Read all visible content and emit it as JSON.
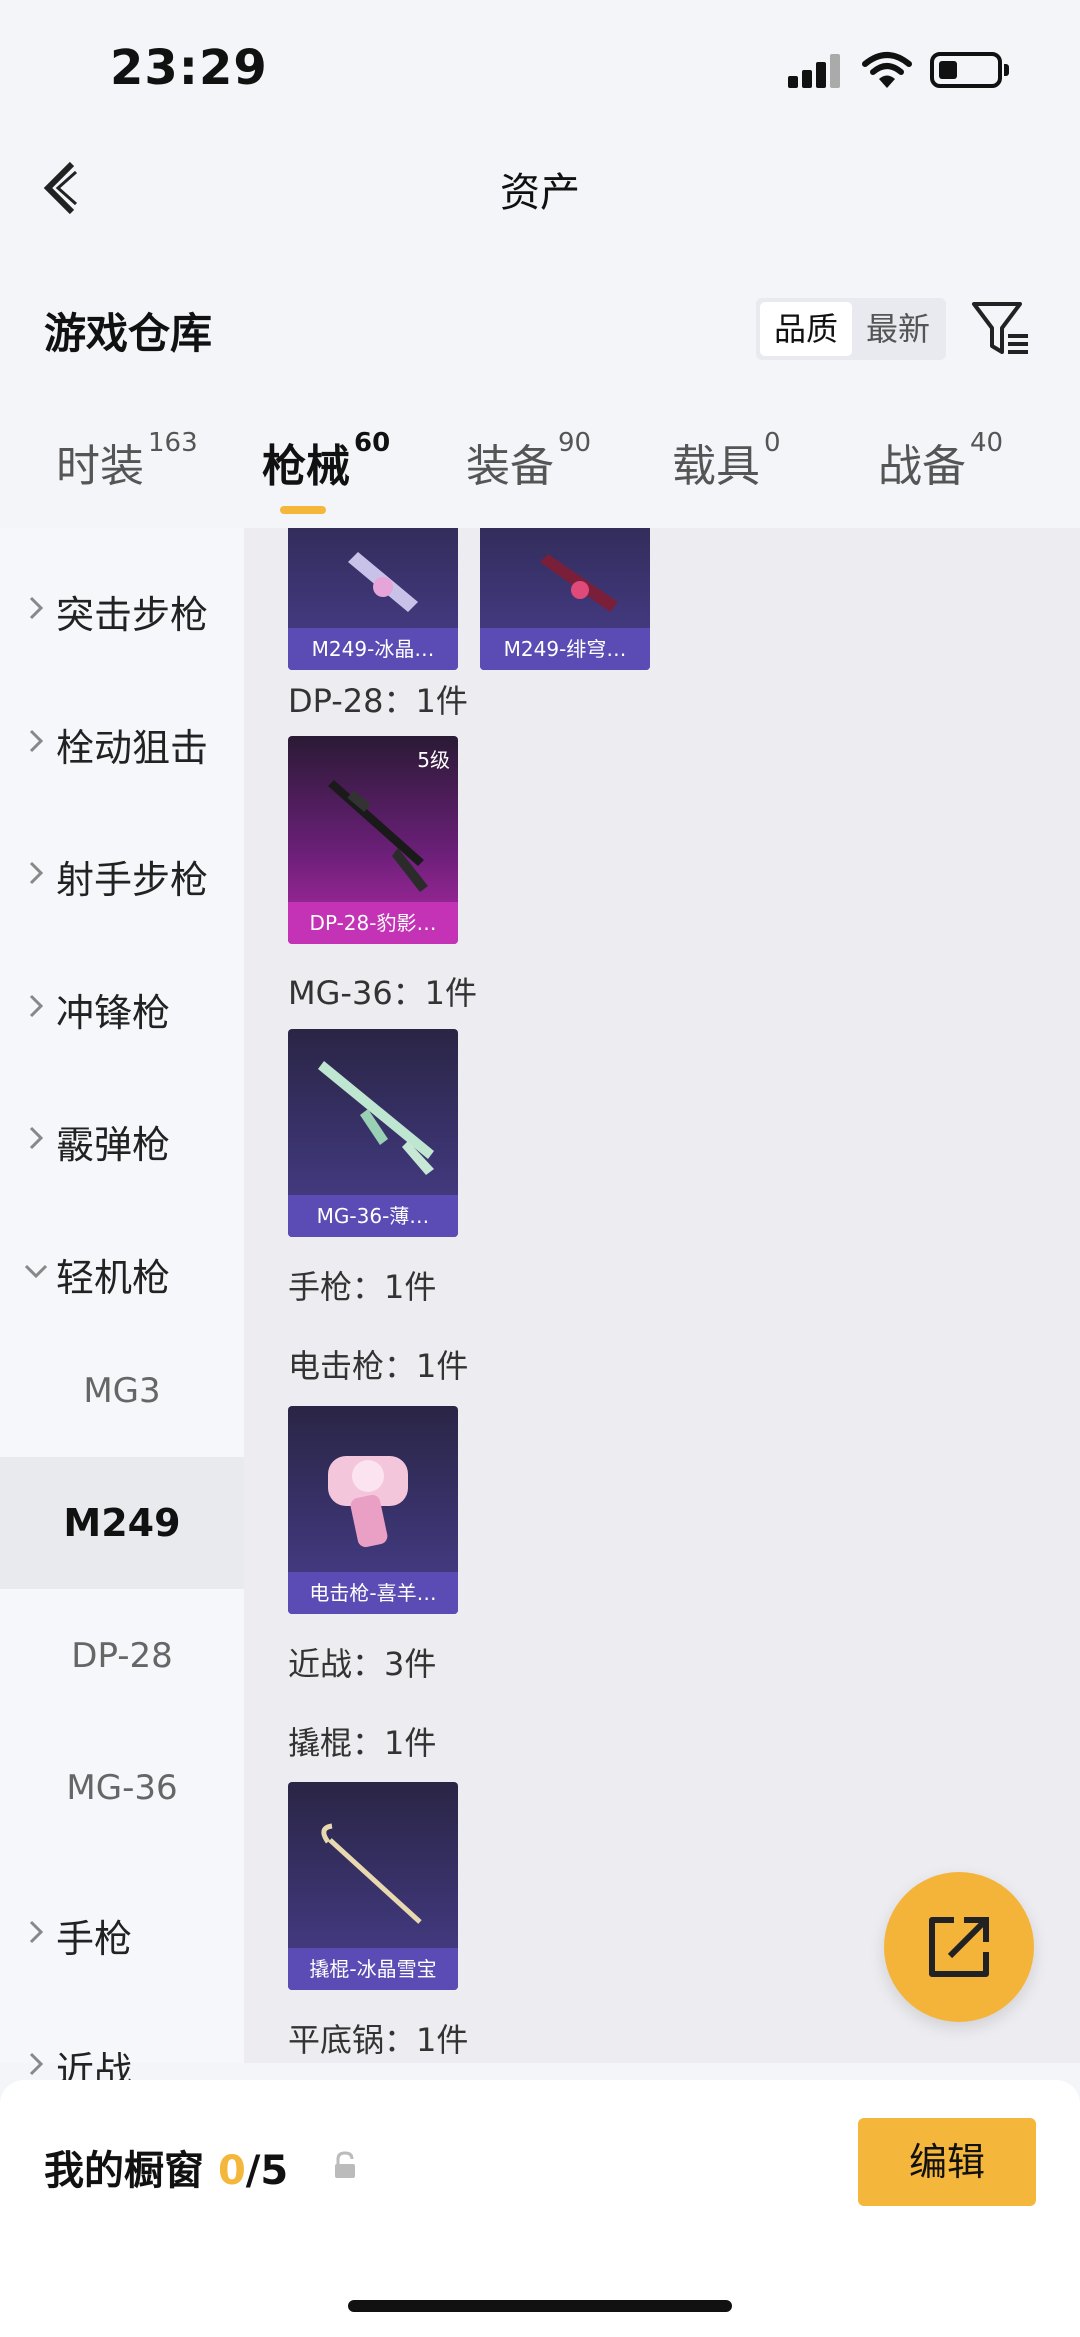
{
  "status": {
    "time": "23:29"
  },
  "nav": {
    "title": "资产"
  },
  "warehouse": {
    "title": "游戏仓库",
    "sort_quality": "品质",
    "sort_latest": "最新"
  },
  "tabs": [
    {
      "label": "时装",
      "count": "163"
    },
    {
      "label": "枪械",
      "count": "60",
      "active": true
    },
    {
      "label": "装备",
      "count": "90"
    },
    {
      "label": "载具",
      "count": "0"
    },
    {
      "label": "战备",
      "count": "40"
    }
  ],
  "sidebar": {
    "categories": [
      {
        "label": "突击步枪"
      },
      {
        "label": "栓动狙击"
      },
      {
        "label": "射手步枪"
      },
      {
        "label": "冲锋枪"
      },
      {
        "label": "霰弹枪"
      },
      {
        "label": "轻机枪",
        "expanded": true
      }
    ],
    "subitems": [
      {
        "label": "MG3"
      },
      {
        "label": "M249",
        "active": true
      },
      {
        "label": "DP-28"
      },
      {
        "label": "MG-36"
      }
    ],
    "categories_after": [
      {
        "label": "手枪"
      },
      {
        "label": "近战"
      }
    ]
  },
  "main": {
    "cards_top": [
      {
        "caption": "M249-冰晶…"
      },
      {
        "caption": "M249-绯穹…"
      }
    ],
    "group_dp28": {
      "label": "DP-28：1件",
      "card": {
        "caption": "DP-28-豹影…",
        "level": "5级"
      }
    },
    "group_mg36": {
      "label": "MG-36：1件",
      "card": {
        "caption": "MG-36-薄…"
      }
    },
    "group_pistol": {
      "label": "手枪：1件"
    },
    "group_stun": {
      "label": "电击枪：1件",
      "card": {
        "caption": "电击枪-喜羊…"
      }
    },
    "group_melee": {
      "label": "近战：3件"
    },
    "group_crowbar": {
      "label": "撬棍：1件",
      "card": {
        "caption": "撬棍-冰晶雪宝"
      }
    },
    "group_pan": {
      "label": "平底锅：1件"
    }
  },
  "bottom": {
    "showcase_label": "我的橱窗",
    "showcase_count": "0",
    "showcase_total": "/5",
    "edit_label": "编辑"
  },
  "colors": {
    "accent": "#f5b73b",
    "card_purple": "#5b4bb4",
    "card_pink": "#c433b5"
  }
}
